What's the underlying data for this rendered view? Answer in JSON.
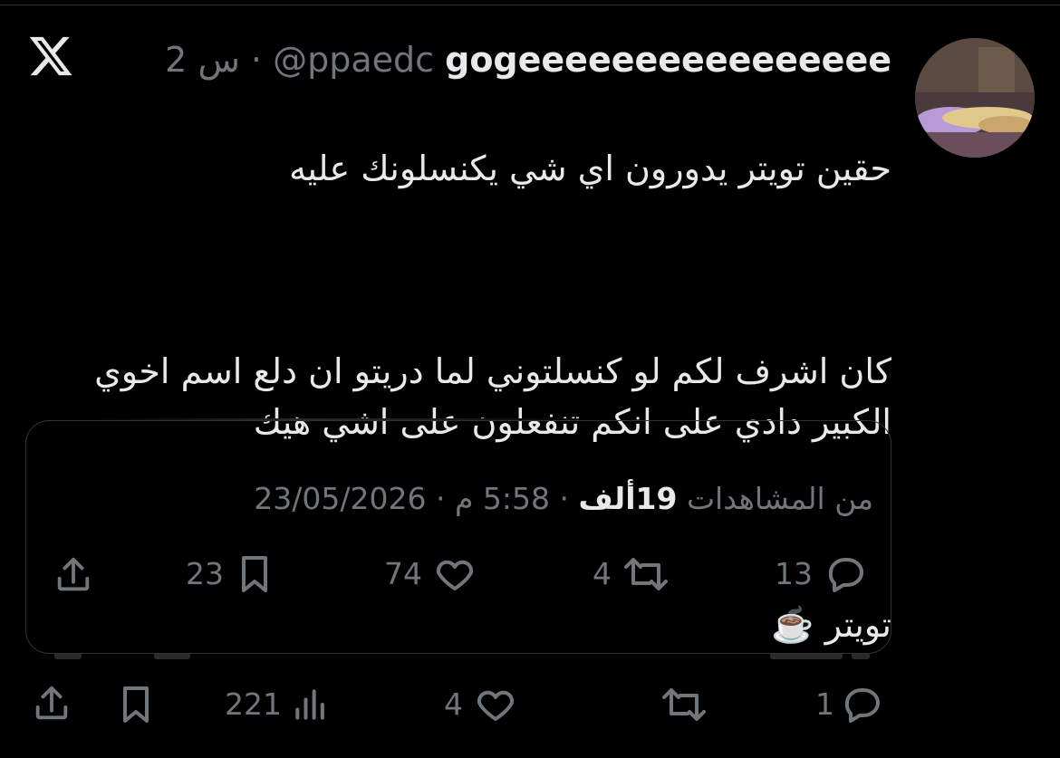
{
  "tweet": {
    "display_name": "gogeeeeeeeeeeeeeeee",
    "handle": "@ppaedc",
    "separator": "·",
    "time": "2 س",
    "text_line1": "حقين تويتر يدورون اي شي يكنسلونك عليه",
    "text_block2": "كان اشرف لكم لو كنسلتوني لما دريتو ان دلع اسم اخوي\nالكبير دادي على انكم تنفعلون على اشي هيك",
    "text_line3": "تويتر ☕️"
  },
  "quote": {
    "date": "23/05/2026",
    "dot": "·",
    "time": "5:58 م",
    "views_number": "19ألف",
    "views_label": "من المشاهدات",
    "actions": {
      "share_icon": "share-icon",
      "bookmarks": "23",
      "likes": "74",
      "retweets": "4",
      "replies": "13"
    }
  },
  "tweet_actions": {
    "share_icon": "share-icon",
    "bookmark_icon": "bookmark-icon",
    "views": "221",
    "likes": "4",
    "retweets": "",
    "replies": "1"
  },
  "colors": {
    "background": "#000000",
    "text": "#e7e9ea",
    "muted": "#71767b",
    "border": "#2f3336"
  }
}
